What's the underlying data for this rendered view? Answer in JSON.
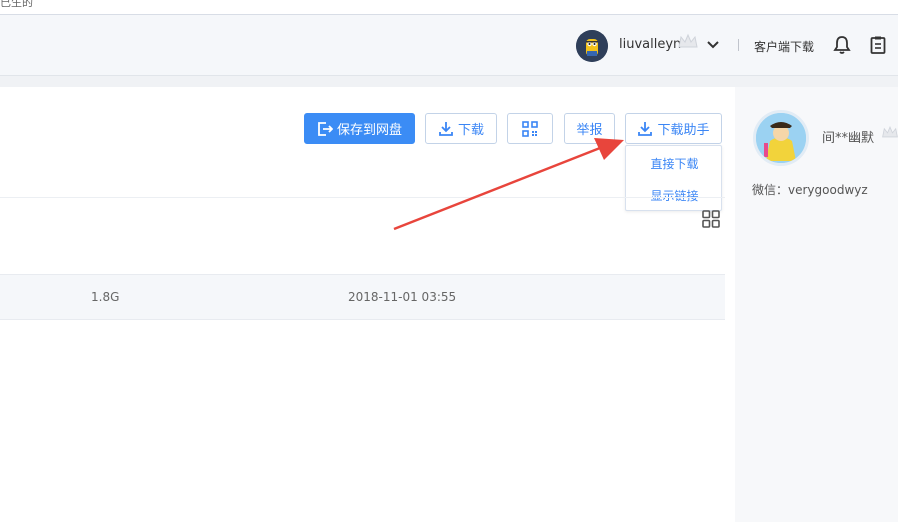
{
  "topstrip": {
    "cut_text": "已生的"
  },
  "header": {
    "username": "liuvalleyn",
    "client_download": "客户端下载"
  },
  "toolbar": {
    "save_to_disk": "保存到网盘",
    "download": "下载",
    "report": "举报",
    "download_helper": "下载助手"
  },
  "dropdown": {
    "direct_download": "直接下载",
    "show_link": "显示链接"
  },
  "file_row": {
    "size": "1.8G",
    "date": "2018-11-01 03:55"
  },
  "uploader": {
    "name": "间**幽默",
    "wechat": "微信：verygoodwyz"
  },
  "colors": {
    "accent": "#3b8cf5",
    "annotation_arrow": "#e8453c"
  }
}
